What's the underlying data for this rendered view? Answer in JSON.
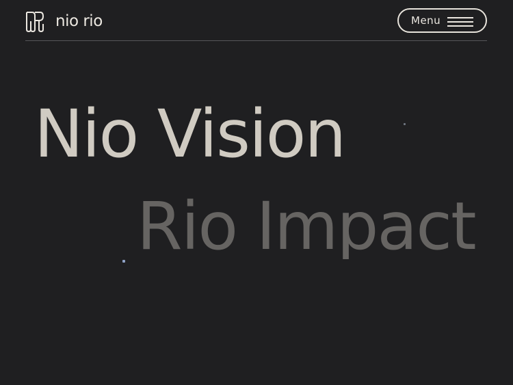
{
  "header": {
    "brand_name": "nio rio",
    "menu_label": "Menu"
  },
  "hero": {
    "line_1": "Nio Vision",
    "line_2": "Rio Impact"
  },
  "icons": {
    "logo": "nio-rio-logo-icon",
    "menu": "hamburger-icon"
  },
  "colors": {
    "background": "#1f1f21",
    "primary_text": "#d0cbc2",
    "secondary_text": "#666462",
    "divider": "#57575a"
  }
}
